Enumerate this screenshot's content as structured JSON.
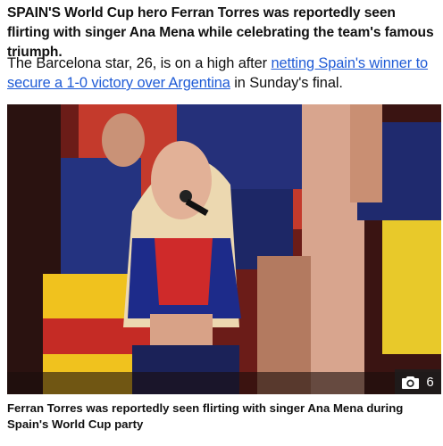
{
  "article": {
    "headline": "SPAIN'S World Cup hero Ferran Torres was reportedly seen flirting with singer Ana Mena while celebrating the team's famous triumph.",
    "standfirst_before": "The Barcelona star, 26, is on a high after ",
    "standfirst_link": "netting Spain's winner to secure a 1-0 victory over Argentina",
    "standfirst_after": " in Sunday's final.",
    "photo": {
      "gallery_icon": "camera-icon",
      "gallery_count": "6",
      "caption": "Ferran Torres was reportedly seen flirting with singer Ana Mena during Spain's World Cup party"
    }
  },
  "colors": {
    "link": "#1f5bd6",
    "text": "#111111",
    "badge_bg": "#1e1e1e"
  }
}
